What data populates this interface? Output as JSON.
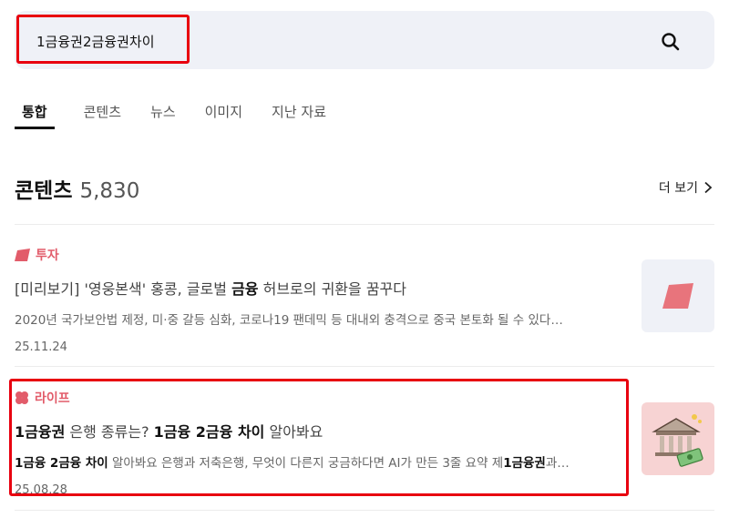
{
  "search": {
    "query": "1금융권2금융권차이"
  },
  "tabs": [
    "통합",
    "콘텐츠",
    "뉴스",
    "이미지",
    "지난 자료"
  ],
  "section": {
    "title": "콘텐츠",
    "count": "5,830",
    "more": "더 보기"
  },
  "results": [
    {
      "category": "투자",
      "title_prefix": "[미리보기] '영웅본색' 홍콩, 글로벌 ",
      "title_bold": "금융",
      "title_suffix": " 허브로의 귀환을 꿈꾸다",
      "description": "2020년 국가보안법 제정, 미·중 갈등 심화, 코로나19 팬데믹 등 대내외 충격으로 중국 본토화 될 수 있다…",
      "date": "25.11.24"
    },
    {
      "category": "라이프",
      "title_bold1": "1금융권",
      "title_plain1": " 은행 종류는? ",
      "title_bold2": "1금융 2금융 차이",
      "title_plain2": " 알아봐요",
      "desc_bold1": "1금융 2금융 차이",
      "desc_plain1": " 알아봐요 은행과 저축은행, 무엇이 다른지 궁금하다면 AI가 만든 3줄 요약 제",
      "desc_bold2": "1금융권",
      "desc_plain2": "과…",
      "date": "25.08.28"
    }
  ],
  "colors": {
    "accent": "#e25c6a",
    "highlight": "#e8000f",
    "search_bg": "#eff1f7"
  },
  "icons": {
    "search": "magnifier-icon",
    "more": "chevron-right-icon",
    "invest": "parallelogram-icon",
    "life": "clover-icon"
  }
}
